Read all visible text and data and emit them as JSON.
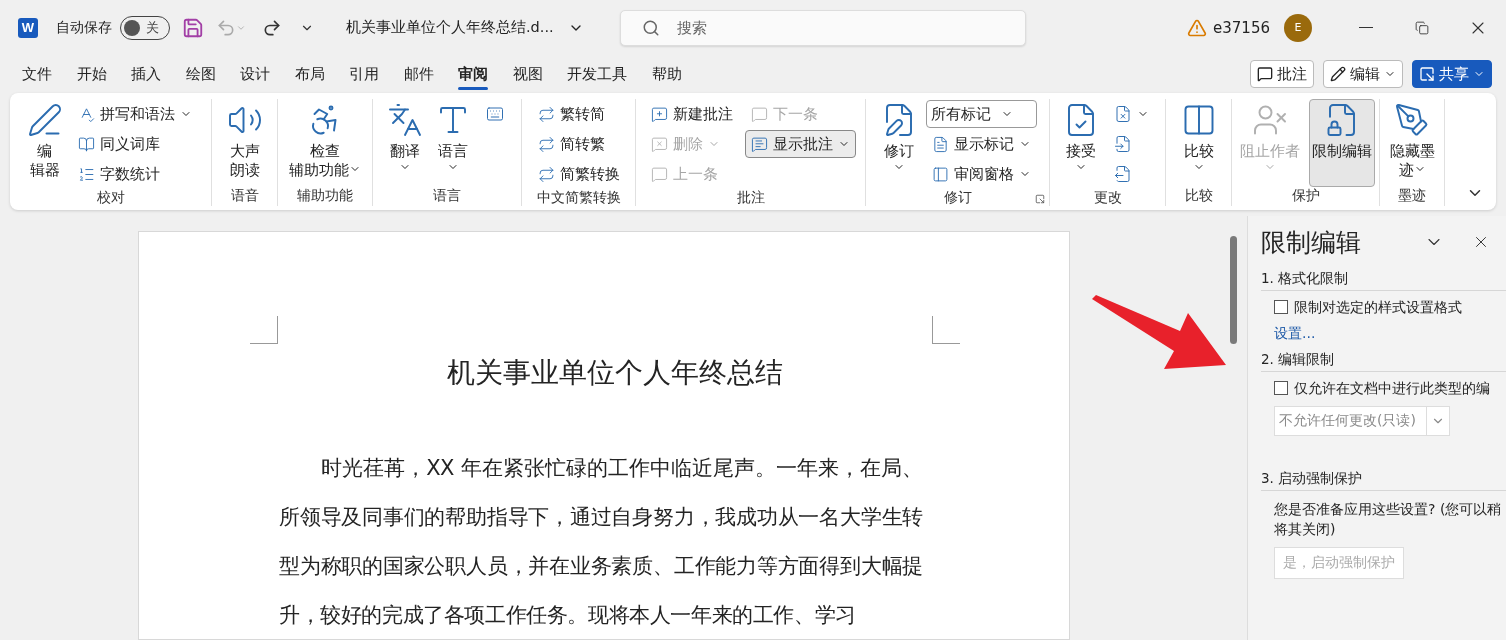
{
  "titlebar": {
    "app_logo": "W",
    "autosave_label": "自动保存",
    "autosave_toggle": {
      "label": "关",
      "on": false
    },
    "undo_disabled": true,
    "document_title": "机关事业单位个人年终总结.d...",
    "search": {
      "placeholder": "搜索"
    },
    "user": "e37156",
    "avatar": "E"
  },
  "menu_tabs": [
    {
      "label": "文件",
      "selected": false
    },
    {
      "label": "开始",
      "selected": false
    },
    {
      "label": "插入",
      "selected": false
    },
    {
      "label": "绘图",
      "selected": false
    },
    {
      "label": "设计",
      "selected": false
    },
    {
      "label": "布局",
      "selected": false
    },
    {
      "label": "引用",
      "selected": false
    },
    {
      "label": "邮件",
      "selected": false
    },
    {
      "label": "审阅",
      "selected": true
    },
    {
      "label": "视图",
      "selected": false
    },
    {
      "label": "开发工具",
      "selected": false
    },
    {
      "label": "帮助",
      "selected": false
    }
  ],
  "header_buttons": [
    {
      "label": "批注",
      "kind": "comment"
    },
    {
      "label": "编辑",
      "kind": "edit"
    },
    {
      "label": "共享",
      "kind": "share"
    }
  ],
  "ribbon": [
    {
      "label": "校对",
      "columns": [
        [
          {
            "kind": "large",
            "lines": [
              "编",
              "辑器"
            ]
          }
        ],
        [
          {
            "kind": "small",
            "label": "拼写和语法",
            "menu": true
          },
          {
            "kind": "small",
            "label": "同义词库"
          },
          {
            "kind": "small",
            "label": "字数统计"
          }
        ]
      ]
    },
    {
      "label": "语音",
      "columns": [
        [
          {
            "kind": "large",
            "lines": [
              "大声",
              "朗读"
            ]
          }
        ]
      ]
    },
    {
      "label": "辅助功能",
      "columns": [
        [
          {
            "kind": "large",
            "lines": [
              "检查",
              "辅助功能"
            ],
            "menu": true
          }
        ]
      ]
    },
    {
      "label": "语言",
      "columns": [
        [
          {
            "kind": "large",
            "lines": [
              "翻译"
            ],
            "menu": true
          }
        ],
        [
          {
            "kind": "large",
            "lines": [
              "语言"
            ],
            "menu": true
          }
        ],
        [
          {
            "kind": "icon"
          }
        ]
      ]
    },
    {
      "label": "中文简繁转换",
      "columns": [
        [
          {
            "kind": "small",
            "label": "繁转简"
          },
          {
            "kind": "small",
            "label": "简转繁"
          },
          {
            "kind": "small",
            "label": "简繁转换"
          }
        ]
      ]
    },
    {
      "label": "批注",
      "columns": [
        [
          {
            "kind": "small",
            "label": "新建批注"
          },
          {
            "kind": "small",
            "label": "删除",
            "disabled": true,
            "menu": true
          },
          {
            "kind": "small",
            "label": "上一条",
            "disabled": true
          }
        ],
        [
          {
            "kind": "small",
            "label": "下一条",
            "disabled": true
          },
          {
            "kind": "small",
            "label": "显示批注",
            "selected": true,
            "menu": true
          }
        ]
      ]
    },
    {
      "label": "修订",
      "columns": [
        [
          {
            "kind": "large",
            "lines": [
              "修订"
            ],
            "menu": true
          }
        ],
        [
          {
            "kind": "dropdown",
            "value": "所有标记"
          },
          {
            "kind": "small",
            "label": "显示标记",
            "menu": true
          },
          {
            "kind": "small",
            "label": "审阅窗格",
            "menu": true
          }
        ]
      ]
    },
    {
      "label": "更改",
      "columns": [
        [
          {
            "kind": "large",
            "lines": [
              "接受"
            ],
            "menu": true
          }
        ],
        [
          {
            "kind": "icon",
            "menu": true
          },
          {
            "kind": "icon"
          },
          {
            "kind": "icon"
          }
        ]
      ]
    },
    {
      "label": "比较",
      "columns": [
        [
          {
            "kind": "large",
            "lines": [
              "比较"
            ],
            "menu": true
          }
        ]
      ]
    },
    {
      "label": "保护",
      "columns": [
        [
          {
            "kind": "large",
            "lines": [
              "阻止作者"
            ],
            "menu": true,
            "disabled": true
          }
        ],
        [
          {
            "kind": "large",
            "lines": [
              "限制编辑"
            ],
            "selected": true
          }
        ]
      ]
    },
    {
      "label": "墨迹",
      "columns": [
        [
          {
            "kind": "large",
            "lines": [
              "隐藏墨",
              "迹"
            ],
            "menu": true
          }
        ]
      ]
    }
  ],
  "document": {
    "title": "机关事业单位个人年终总结",
    "paragraph": "时光荏苒，XX 年在紧张忙碌的工作中临近尾声。一年来，在局、所领导及同事们的帮助指导下，通过自身努力，我成功从一名大学生转型为称职的国家公职人员，并在业务素质、工作能力等方面得到大幅提升，较好的完成了各项工作任务。现将本人一年来的工作、学习"
  },
  "panel": {
    "title": "限制编辑",
    "sections": [
      {
        "heading": "1. 格式化限制",
        "items": [
          {
            "kind": "checkbox",
            "label": "限制对选定的样式设置格式",
            "checked": false
          },
          {
            "kind": "link",
            "label": "设置..."
          }
        ]
      },
      {
        "heading": "2. 编辑限制",
        "items": [
          {
            "kind": "checkbox",
            "label": "仅允许在文档中进行此类型的编",
            "checked": false
          },
          {
            "kind": "select",
            "value": "不允许任何更改(只读)",
            "disabled": true
          }
        ]
      },
      {
        "heading": "3. 启动强制保护",
        "items": [
          {
            "kind": "text",
            "label": "您是否准备应用这些设置? (您可以稍将其关闭)"
          },
          {
            "kind": "button",
            "label": "是，启动强制保护",
            "disabled": true
          }
        ]
      }
    ]
  }
}
